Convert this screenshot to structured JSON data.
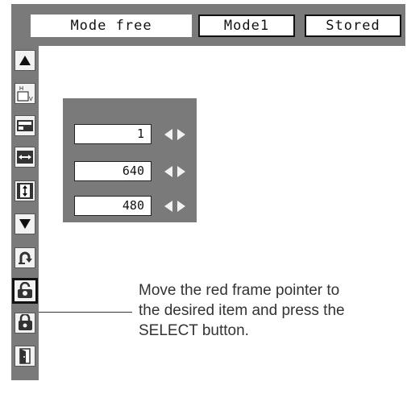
{
  "header": {
    "mode_label": "Mode free",
    "mode1_label": "Mode1",
    "stored_label": "Stored"
  },
  "sidebar": {
    "items": [
      {
        "name": "scroll-up",
        "icon": "triangle-up-icon"
      },
      {
        "name": "total-dots",
        "icon": "hv-screen-icon"
      },
      {
        "name": "horizontal-position",
        "icon": "horizontal-position-icon"
      },
      {
        "name": "horizontal-width",
        "icon": "horizontal-width-icon"
      },
      {
        "name": "vertical-height",
        "icon": "vertical-height-icon"
      },
      {
        "name": "scroll-down",
        "icon": "triangle-down-icon"
      },
      {
        "name": "reset",
        "icon": "reset-arrow-icon"
      },
      {
        "name": "mode-free",
        "icon": "unlock-icon",
        "selected": true
      },
      {
        "name": "store",
        "icon": "store-icon"
      },
      {
        "name": "quit",
        "icon": "door-icon"
      }
    ]
  },
  "values": [
    {
      "value": "1"
    },
    {
      "value": "640"
    },
    {
      "value": "480"
    }
  ],
  "instruction": {
    "text": "Move the red frame pointer to\nthe desired item and press the\nSELECT button."
  },
  "colors": {
    "panel": "#7a7a7a",
    "icon_bg": "#f2f2f2",
    "arrow": "#f2f2f2"
  }
}
